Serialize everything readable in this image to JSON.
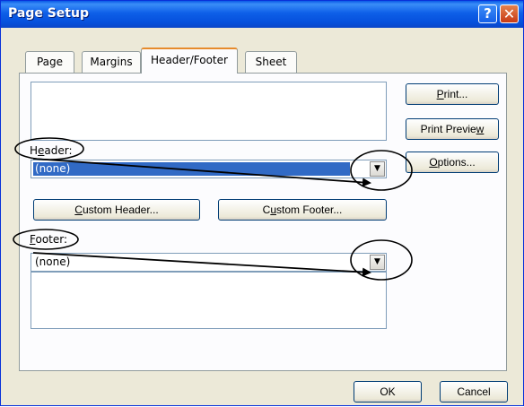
{
  "window": {
    "title": "Page Setup",
    "help_symbol": "?",
    "close_symbol": "✕"
  },
  "tabs": [
    {
      "label": "Page",
      "active": false
    },
    {
      "label": "Margins",
      "active": false
    },
    {
      "label": "Header/Footer",
      "active": true
    },
    {
      "label": "Sheet",
      "active": false
    }
  ],
  "header": {
    "label_pre": "H",
    "label_accel": "e",
    "label_post": "ader:",
    "value": "(none)",
    "arrow": "▼"
  },
  "footer": {
    "label_accel": "F",
    "label_post": "ooter:",
    "value": "(none)",
    "arrow": "▼"
  },
  "buttons": {
    "custom_header": {
      "accel": "C",
      "rest": "ustom Header..."
    },
    "custom_footer": {
      "pre": "C",
      "accel": "u",
      "rest": "stom Footer..."
    },
    "print": {
      "accel": "P",
      "rest": "rint..."
    },
    "print_preview": {
      "pre": "Print Previe",
      "accel": "w",
      "rest": ""
    },
    "options": {
      "accel": "O",
      "rest": "ptions..."
    },
    "ok": "OK",
    "cancel": "Cancel"
  }
}
